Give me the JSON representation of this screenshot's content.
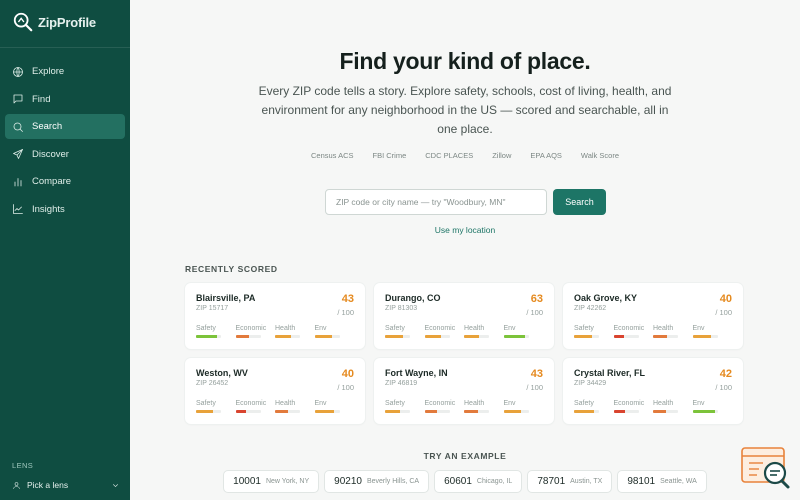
{
  "brand": {
    "name": "ZipProfile"
  },
  "sidebar": {
    "items": [
      {
        "label": "Explore",
        "icon": "globe-icon",
        "active": false
      },
      {
        "label": "Find",
        "icon": "chat-icon",
        "active": false
      },
      {
        "label": "Search",
        "icon": "search-icon",
        "active": true
      },
      {
        "label": "Discover",
        "icon": "send-icon",
        "active": false
      },
      {
        "label": "Compare",
        "icon": "bar-chart-icon",
        "active": false
      },
      {
        "label": "Insights",
        "icon": "trend-icon",
        "active": false
      }
    ],
    "lens_label": "LENS",
    "lens_picker": "Pick a lens"
  },
  "hero": {
    "title": "Find your kind of place.",
    "subtitle": "Every ZIP code tells a story. Explore safety, schools, cost of living, health, and environment for any neighborhood in the US — scored and searchable, all in one place."
  },
  "sources": [
    "Census ACS",
    "FBI Crime",
    "CDC PLACES",
    "Zillow",
    "EPA AQS",
    "Walk Score"
  ],
  "search": {
    "placeholder": "ZIP code or city name — try \"Woodbury, MN\"",
    "button": "Search",
    "use_location": "Use my location"
  },
  "recent": {
    "heading": "RECENTLY SCORED",
    "metric_labels": [
      "Safety",
      "Economic",
      "Health",
      "Env"
    ],
    "cards": [
      {
        "city": "Blairsville, PA",
        "zip": "ZIP 15717",
        "score": "43",
        "denom": "/ 100",
        "metrics": [
          {
            "value": 0.82,
            "color": "#7cc33a"
          },
          {
            "value": 0.55,
            "color": "#e27a3c"
          },
          {
            "value": 0.62,
            "color": "#e8a23a"
          },
          {
            "value": 0.68,
            "color": "#e8a23a"
          }
        ]
      },
      {
        "city": "Durango, CO",
        "zip": "ZIP 81303",
        "score": "63",
        "denom": "/ 100",
        "metrics": [
          {
            "value": 0.72,
            "color": "#e8a23a"
          },
          {
            "value": 0.66,
            "color": "#e8a23a"
          },
          {
            "value": 0.6,
            "color": "#e8a23a"
          },
          {
            "value": 0.86,
            "color": "#7cc33a"
          }
        ]
      },
      {
        "city": "Oak Grove, KY",
        "zip": "ZIP 42262",
        "score": "40",
        "denom": "/ 100",
        "metrics": [
          {
            "value": 0.7,
            "color": "#e8a23a"
          },
          {
            "value": 0.4,
            "color": "#d9442f"
          },
          {
            "value": 0.54,
            "color": "#e27a3c"
          },
          {
            "value": 0.74,
            "color": "#e8a23a"
          }
        ]
      },
      {
        "city": "Weston, WV",
        "zip": "ZIP 26452",
        "score": "40",
        "denom": "/ 100",
        "metrics": [
          {
            "value": 0.68,
            "color": "#e8a23a"
          },
          {
            "value": 0.42,
            "color": "#d9442f"
          },
          {
            "value": 0.5,
            "color": "#e27a3c"
          },
          {
            "value": 0.76,
            "color": "#e8a23a"
          }
        ]
      },
      {
        "city": "Fort Wayne, IN",
        "zip": "ZIP 46819",
        "score": "43",
        "denom": "/ 100",
        "metrics": [
          {
            "value": 0.6,
            "color": "#e8a23a"
          },
          {
            "value": 0.5,
            "color": "#e27a3c"
          },
          {
            "value": 0.56,
            "color": "#e27a3c"
          },
          {
            "value": 0.7,
            "color": "#e8a23a"
          }
        ]
      },
      {
        "city": "Crystal River, FL",
        "zip": "ZIP 34429",
        "score": "42",
        "denom": "/ 100",
        "metrics": [
          {
            "value": 0.78,
            "color": "#e8a23a"
          },
          {
            "value": 0.44,
            "color": "#d9442f"
          },
          {
            "value": 0.5,
            "color": "#e27a3c"
          },
          {
            "value": 0.88,
            "color": "#7cc33a"
          }
        ]
      }
    ]
  },
  "examples": {
    "heading": "TRY AN EXAMPLE",
    "items": [
      {
        "zip": "10001",
        "place": "New York, NY"
      },
      {
        "zip": "90210",
        "place": "Beverly Hills, CA"
      },
      {
        "zip": "60601",
        "place": "Chicago, IL"
      },
      {
        "zip": "78701",
        "place": "Austin, TX"
      },
      {
        "zip": "98101",
        "place": "Seattle, WA"
      }
    ]
  },
  "colors": {
    "sidebar": "#0f4d41",
    "accent": "#1d7566",
    "score": "#e58a1f"
  }
}
